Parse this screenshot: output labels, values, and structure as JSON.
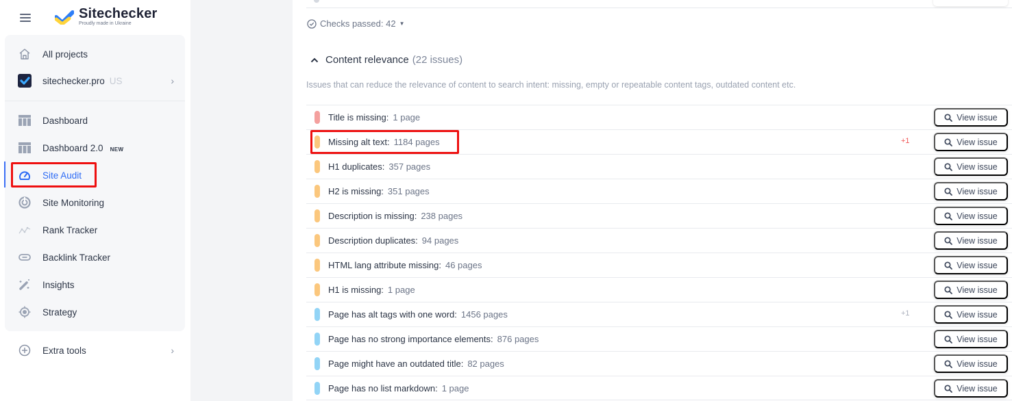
{
  "brand": {
    "name": "Sitechecker",
    "tagline": "Proudly made in Ukraine"
  },
  "sidebar": {
    "all_projects": "All projects",
    "project": {
      "name": "sitechecker.pro",
      "region": "US"
    },
    "items": [
      {
        "label": "Dashboard",
        "icon": "dashboard-icon"
      },
      {
        "label": "Dashboard 2.0",
        "badge": "NEW",
        "icon": "dashboard-icon"
      },
      {
        "label": "Site Audit",
        "icon": "gauge-icon",
        "active": true
      },
      {
        "label": "Site Monitoring",
        "icon": "radar-icon"
      },
      {
        "label": "Rank Tracker",
        "icon": "trend-line-icon"
      },
      {
        "label": "Backlink Tracker",
        "icon": "link-icon"
      },
      {
        "label": "Insights",
        "icon": "magic-wand-icon"
      },
      {
        "label": "Strategy",
        "icon": "target-icon"
      }
    ],
    "extra_tools": "Extra tools"
  },
  "main": {
    "checks_passed": "Checks passed: 42",
    "section": {
      "title": "Content relevance",
      "count": "(22 issues)",
      "description": "Issues that can reduce the relevance of content to search intent: missing, empty or repeatable content tags, outdated content etc."
    },
    "view_issue_label": "View issue",
    "colors": {
      "error": "#f4a09e",
      "warning": "#fbc77d",
      "notice": "#92d4f6",
      "delta_red": "#f05454",
      "delta_grey": "#a9afbb",
      "accent": "#2d6bf5"
    },
    "issues": [
      {
        "name": "Title is missing:",
        "count": "1 page",
        "severity": "error",
        "delta": ""
      },
      {
        "name": "Missing alt text:",
        "count": "1184 pages",
        "severity": "warning",
        "delta": "+1",
        "delta_color": "red"
      },
      {
        "name": "H1 duplicates:",
        "count": "357 pages",
        "severity": "warning",
        "delta": ""
      },
      {
        "name": "H2 is missing:",
        "count": "351 pages",
        "severity": "warning",
        "delta": ""
      },
      {
        "name": "Description is missing:",
        "count": "238 pages",
        "severity": "warning",
        "delta": ""
      },
      {
        "name": "Description duplicates:",
        "count": "94 pages",
        "severity": "warning",
        "delta": ""
      },
      {
        "name": "HTML lang attribute missing:",
        "count": "46 pages",
        "severity": "warning",
        "delta": ""
      },
      {
        "name": "H1 is missing:",
        "count": "1 page",
        "severity": "warning",
        "delta": ""
      },
      {
        "name": "Page has alt tags with one word:",
        "count": "1456 pages",
        "severity": "notice",
        "delta": "+1",
        "delta_color": "grey"
      },
      {
        "name": "Page has no strong importance elements:",
        "count": "876 pages",
        "severity": "notice",
        "delta": ""
      },
      {
        "name": "Page might have an outdated title:",
        "count": "82 pages",
        "severity": "notice",
        "delta": ""
      },
      {
        "name": "Page has no list markdown:",
        "count": "1 page",
        "severity": "notice",
        "delta": ""
      }
    ]
  }
}
